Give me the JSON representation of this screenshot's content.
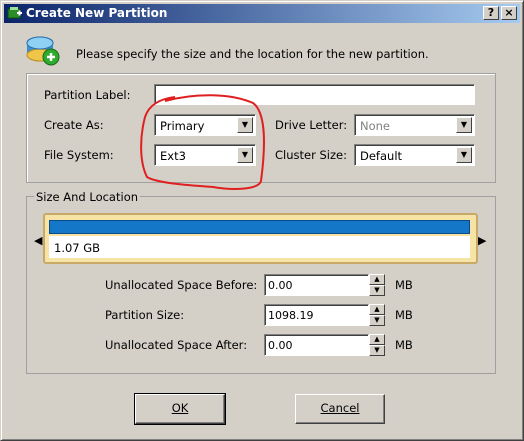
{
  "window": {
    "title": "Create New Partition",
    "help_symbol": "?",
    "close_symbol": "×"
  },
  "header": {
    "instruction": "Please specify the size and the location for the new partition."
  },
  "form": {
    "partition_label_label": "Partition Label:",
    "partition_label_value": "",
    "create_as_label": "Create As:",
    "create_as_value": "Primary",
    "file_system_label": "File System:",
    "file_system_value": "Ext3",
    "drive_letter_label": "Drive Letter:",
    "drive_letter_value": "None",
    "cluster_size_label": "Cluster Size:",
    "cluster_size_value": "Default"
  },
  "size_location": {
    "group_title": "Size And Location",
    "bar_label": "1.07 GB",
    "unallocated_before_label": "Unallocated Space Before:",
    "unallocated_before_value": "0.00",
    "partition_size_label": "Partition Size:",
    "partition_size_value": "1098.19",
    "unallocated_after_label": "Unallocated Space After:",
    "unallocated_after_value": "0.00",
    "unit": "MB"
  },
  "buttons": {
    "ok_label": "OK",
    "cancel_label": "Cancel"
  },
  "colors": {
    "titlebar_start": "#0a246a",
    "titlebar_end": "#a6caf0",
    "partition_bar": "#1477c8",
    "annotation": "#e02020",
    "dialog_bg": "#d4d0c8"
  },
  "icons": {
    "app": "partition-wizard-icon",
    "header": "new-partition-icon"
  }
}
